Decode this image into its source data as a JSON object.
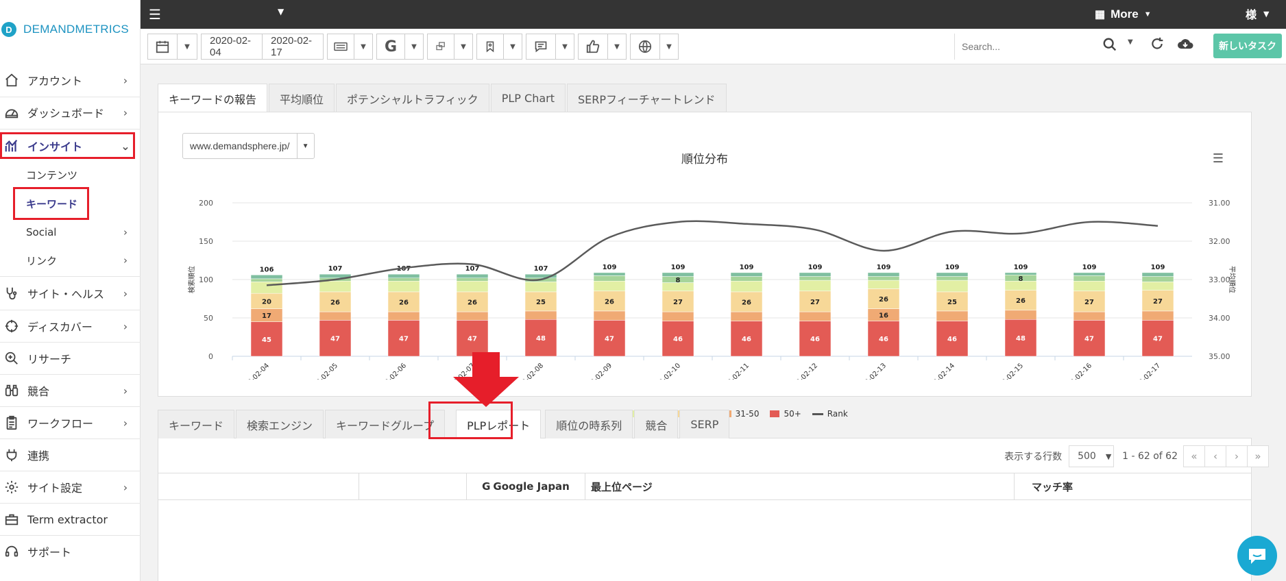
{
  "brand": {
    "mark": "D",
    "name": "DEMANDMETRICS"
  },
  "sidebar": {
    "items": [
      {
        "label": "アカウント",
        "icon": "home-icon",
        "chevron": "›"
      },
      {
        "label": "ダッシュボード",
        "icon": "gauge-icon",
        "chevron": "›"
      },
      {
        "label": "インサイト",
        "icon": "chart-icon",
        "chevron": "⌄",
        "active": true
      },
      {
        "label": "コンテンツ"
      },
      {
        "label": "キーワード",
        "active": true
      },
      {
        "label": "Social",
        "chevron": "›"
      },
      {
        "label": "リンク",
        "chevron": "›"
      },
      {
        "label": "サイト・ヘルス",
        "icon": "stethoscope-icon",
        "chevron": "›"
      },
      {
        "label": "ディスカバー",
        "icon": "crosshair-icon",
        "chevron": "›"
      },
      {
        "label": "リサーチ",
        "icon": "zoom-in-icon",
        "chevron": ""
      },
      {
        "label": "競合",
        "icon": "binoculars-icon",
        "chevron": "›"
      },
      {
        "label": "ワークフロー",
        "icon": "clipboard-icon",
        "chevron": "›"
      },
      {
        "label": "連携",
        "icon": "plug-icon",
        "chevron": ""
      },
      {
        "label": "サイト設定",
        "icon": "gear-icon",
        "chevron": "›"
      },
      {
        "label": "Term extractor",
        "icon": "toolbox-icon",
        "chevron": ""
      },
      {
        "label": "サポート",
        "icon": "headset-icon",
        "chevron": ""
      }
    ]
  },
  "topbar": {
    "more_label": "More",
    "user_label": "様"
  },
  "toolbar": {
    "start_date": "2020-02-04",
    "end_date": "2020-02-17",
    "search_placeholder": "Search...",
    "new_task_label": "新しいタスク"
  },
  "report_tabs": [
    "キーワードの報告",
    "平均順位",
    "ポテンシャルトラフィック",
    "PLP Chart",
    "SERPフィーチャートレンド"
  ],
  "domain_select": "www.demandsphere.jp/",
  "bottom_tabs": [
    "キーワード",
    "検索エンジン",
    "キーワードグループ",
    "PLPレポート",
    "順位の時系列",
    "競合",
    "SERP"
  ],
  "pager": {
    "rows_label": "表示する行数",
    "rows_value": "500",
    "info": "1 - 62 of 62"
  },
  "table_headers": [
    "",
    "",
    "Google Japan",
    "最上位ページ",
    "マッチ率"
  ],
  "colors": {
    "rank_1": "#7fbfa0",
    "rank_2_3": "#a6d49a",
    "rank_4_10": "#e2efa4",
    "rank_11_30": "#f7d898",
    "rank_31_50": "#f0aa74",
    "rank_50_plus": "#e35b55",
    "rank_line": "#5a5a5a",
    "highlight": "#e61e2a"
  },
  "chart_data": {
    "type": "bar",
    "title": "順位分布",
    "ylabel": "検索順位",
    "y2label": "平均順位",
    "ylim": [
      0,
      200
    ],
    "y2lim": [
      31,
      35
    ],
    "y2_reversed": true,
    "yticks": [
      0,
      50,
      100,
      150,
      200
    ],
    "y2ticks": [
      "31.00",
      "32.00",
      "33.00",
      "34.00",
      "35.00"
    ],
    "categories": [
      "2020-02-04",
      "2020-02-05",
      "2020-02-06",
      "2020-02-07",
      "2020-02-08",
      "2020-02-09",
      "2020-02-10",
      "2020-02-11",
      "2020-02-12",
      "2020-02-13",
      "2020-02-14",
      "2020-02-15",
      "2020-02-16",
      "2020-02-17"
    ],
    "totals": [
      106,
      107,
      107,
      107,
      107,
      109,
      109,
      109,
      109,
      109,
      109,
      109,
      109,
      109
    ],
    "series": [
      {
        "name": "50+",
        "values": [
          45,
          47,
          47,
          47,
          48,
          47,
          46,
          46,
          46,
          46,
          46,
          48,
          47,
          47
        ]
      },
      {
        "name": "31-50",
        "values": [
          17,
          11,
          11,
          11,
          11,
          12,
          12,
          12,
          12,
          16,
          13,
          12,
          11,
          12
        ]
      },
      {
        "name": "11-30",
        "values": [
          20,
          26,
          26,
          26,
          25,
          26,
          27,
          26,
          27,
          26,
          25,
          26,
          27,
          27
        ]
      },
      {
        "name": "4-10",
        "values": [
          15,
          14,
          14,
          14,
          13,
          13,
          11,
          14,
          14,
          11,
          15,
          12,
          13,
          11
        ]
      },
      {
        "name": "2-3",
        "values": [
          4,
          4,
          4,
          4,
          5,
          7,
          8,
          6,
          5,
          5,
          5,
          8,
          7,
          7
        ]
      },
      {
        "name": "1",
        "values": [
          5,
          5,
          5,
          5,
          5,
          4,
          5,
          5,
          5,
          5,
          5,
          3,
          4,
          5
        ]
      }
    ],
    "line": {
      "name": "Rank",
      "values": [
        33.15,
        33.0,
        32.7,
        32.6,
        33.0,
        31.9,
        31.5,
        31.55,
        31.7,
        32.25,
        31.75,
        31.8,
        31.5,
        31.6
      ]
    },
    "legend": [
      "1",
      "2-3",
      "4-10",
      "11-30",
      "31-50",
      "50+",
      "Rank"
    ],
    "legend_position": "bottom"
  }
}
